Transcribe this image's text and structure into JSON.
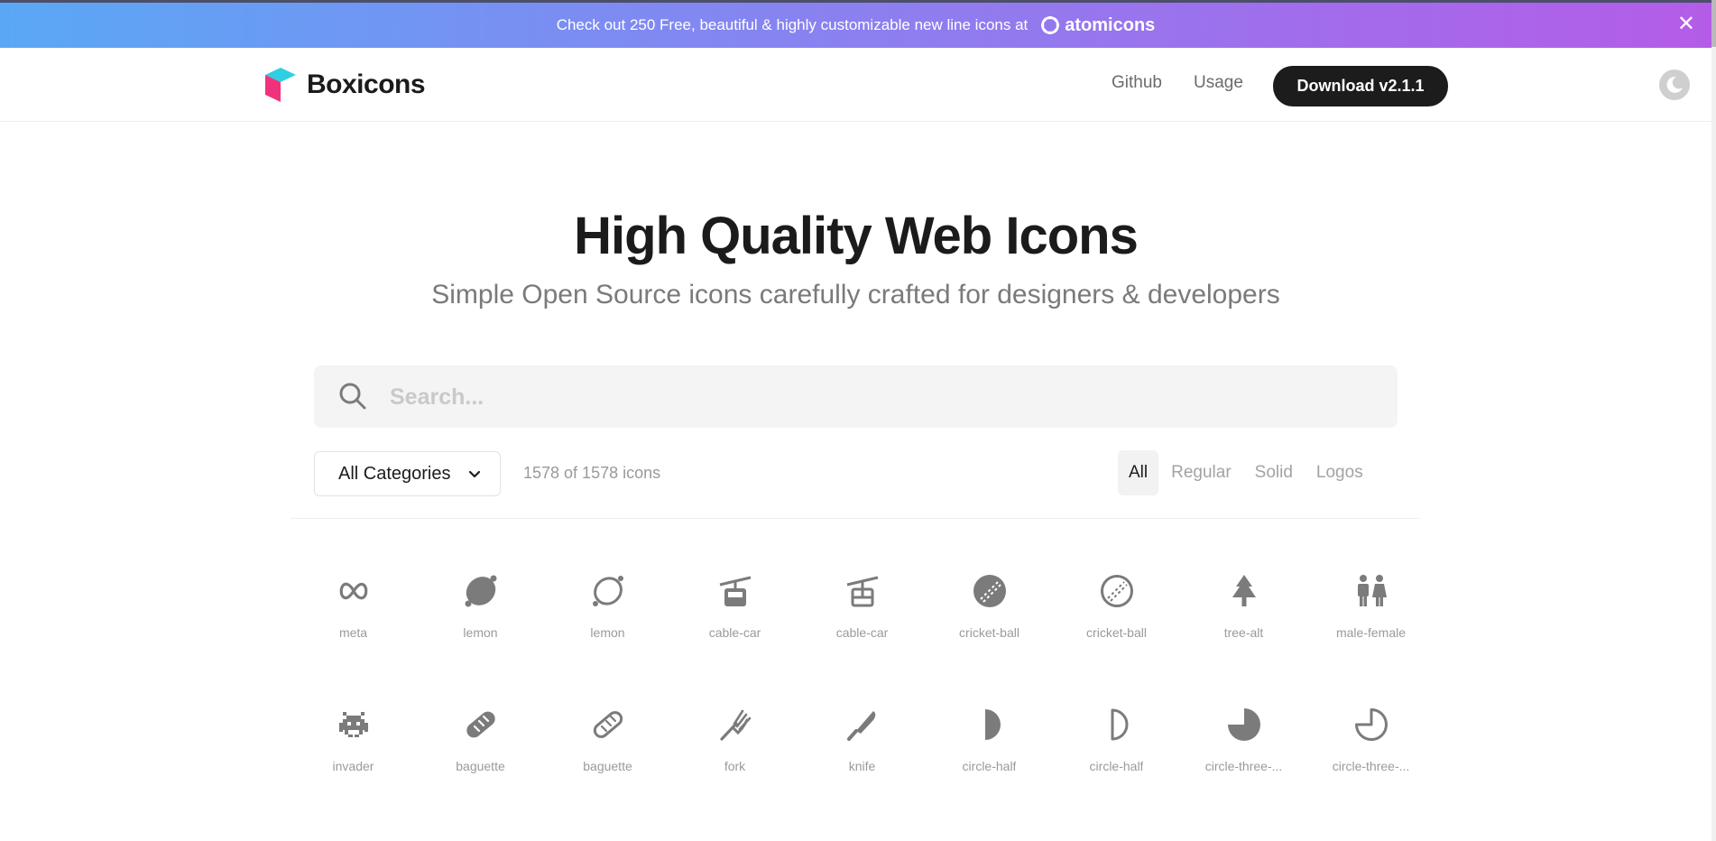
{
  "banner": {
    "text": "Check out 250 Free, beautiful & highly customizable new line icons at",
    "brand": "atomicons",
    "close_icon": "close-icon"
  },
  "navbar": {
    "logo_text": "Boxicons",
    "links": [
      "Github",
      "Usage"
    ],
    "download_label": "Download v2.1.1",
    "theme_icon": "moon-icon"
  },
  "hero": {
    "title": "High Quality Web Icons",
    "subtitle": "Simple Open Source icons carefully crafted for designers & developers"
  },
  "search": {
    "placeholder": "Search...",
    "value": "",
    "icon": "search-icon"
  },
  "filters": {
    "category": "All Categories",
    "count": "1578 of 1578 icons",
    "tabs": [
      "All",
      "Regular",
      "Solid",
      "Logos"
    ],
    "active_tab": "All"
  },
  "icons": [
    {
      "label": "meta",
      "icon": "meta-icon"
    },
    {
      "label": "lemon",
      "icon": "lemon-solid-icon"
    },
    {
      "label": "lemon",
      "icon": "lemon-regular-icon"
    },
    {
      "label": "cable-car",
      "icon": "cable-car-solid-icon"
    },
    {
      "label": "cable-car",
      "icon": "cable-car-regular-icon"
    },
    {
      "label": "cricket-ball",
      "icon": "cricket-ball-solid-icon"
    },
    {
      "label": "cricket-ball",
      "icon": "cricket-ball-regular-icon"
    },
    {
      "label": "tree-alt",
      "icon": "tree-alt-icon"
    },
    {
      "label": "male-female",
      "icon": "male-female-icon"
    },
    {
      "label": "invader",
      "icon": "invader-icon"
    },
    {
      "label": "baguette",
      "icon": "baguette-solid-icon"
    },
    {
      "label": "baguette",
      "icon": "baguette-regular-icon"
    },
    {
      "label": "fork",
      "icon": "fork-icon"
    },
    {
      "label": "knife",
      "icon": "knife-icon"
    },
    {
      "label": "circle-half",
      "icon": "circle-half-solid-icon"
    },
    {
      "label": "circle-half",
      "icon": "circle-half-regular-icon"
    },
    {
      "label": "circle-three-...",
      "icon": "circle-three-quarter-solid-icon"
    },
    {
      "label": "circle-three-...",
      "icon": "circle-three-quarter-regular-icon"
    }
  ],
  "colors": {
    "banner_gradient_start": "#5aa8f5",
    "banner_gradient_end": "#b45ce8",
    "logo_cyan": "#2ecfe0",
    "logo_pink": "#f0327d",
    "button_dark": "#1c1c1c",
    "icon_gray": "#7b7b7b"
  }
}
